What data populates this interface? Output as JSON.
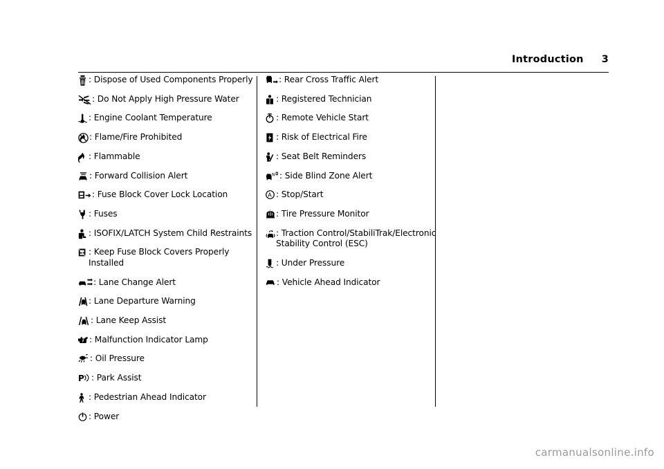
{
  "header": {
    "title": "Introduction",
    "page_number": "3"
  },
  "footer": {
    "text": "carmanualsonline.info"
  },
  "columns": [
    {
      "id": "column-1",
      "entries": [
        {
          "icon": "dispose-used-components-icon",
          "label": ": Dispose of Used Components Properly"
        },
        {
          "icon": "no-high-pressure-water-icon",
          "label": ": Do Not Apply High Pressure Water"
        },
        {
          "icon": "engine-coolant-temperature-icon",
          "label": ": Engine Coolant Temperature"
        },
        {
          "icon": "flame-fire-prohibited-icon",
          "label": ": Flame/Fire Prohibited"
        },
        {
          "icon": "flammable-icon",
          "label": ": Flammable"
        },
        {
          "icon": "forward-collision-alert-icon",
          "label": ": Forward Collision Alert"
        },
        {
          "icon": "fuse-block-cover-lock-location-icon",
          "label": ": Fuse Block Cover Lock Location"
        },
        {
          "icon": "fuses-icon",
          "label": ": Fuses"
        },
        {
          "icon": "isofix-latch-child-restraints-icon",
          "label": ": ISOFIX/LATCH System Child Restraints"
        },
        {
          "icon": "keep-fuse-block-covers-icon",
          "label": ": Keep Fuse Block Covers Properly Installed"
        },
        {
          "icon": "lane-change-alert-icon",
          "label": ": Lane Change Alert"
        },
        {
          "icon": "lane-departure-warning-icon",
          "label": ": Lane Departure Warning"
        },
        {
          "icon": "lane-keep-assist-icon",
          "label": ": Lane Keep Assist"
        },
        {
          "icon": "malfunction-indicator-lamp-icon",
          "label": ": Malfunction Indicator Lamp"
        },
        {
          "icon": "oil-pressure-icon",
          "label": ": Oil Pressure"
        },
        {
          "icon": "park-assist-icon",
          "label": ": Park Assist"
        },
        {
          "icon": "pedestrian-ahead-indicator-icon",
          "label": ": Pedestrian Ahead Indicator"
        },
        {
          "icon": "power-icon",
          "label": ": Power"
        }
      ]
    },
    {
      "id": "column-2",
      "entries": [
        {
          "icon": "rear-cross-traffic-alert-icon",
          "label": ": Rear Cross Traffic Alert"
        },
        {
          "icon": "registered-technician-icon",
          "label": ": Registered Technician"
        },
        {
          "icon": "remote-vehicle-start-icon",
          "label": ": Remote Vehicle Start"
        },
        {
          "icon": "risk-of-electrical-fire-icon",
          "label": ": Risk of Electrical Fire"
        },
        {
          "icon": "seat-belt-reminders-icon",
          "label": ": Seat Belt Reminders"
        },
        {
          "icon": "side-blind-zone-alert-icon",
          "label": ": Side Blind Zone Alert"
        },
        {
          "icon": "stop-start-icon",
          "label": ": Stop/Start"
        },
        {
          "icon": "tire-pressure-monitor-icon",
          "label": ": Tire Pressure Monitor"
        },
        {
          "icon": "traction-control-stabilitrak-icon",
          "label": ": Traction Control/StabiliTrak/Electronic Stability Control (ESC)"
        },
        {
          "icon": "under-pressure-icon",
          "label": ": Under Pressure"
        },
        {
          "icon": "vehicle-ahead-indicator-icon",
          "label": ": Vehicle Ahead Indicator"
        }
      ]
    }
  ]
}
